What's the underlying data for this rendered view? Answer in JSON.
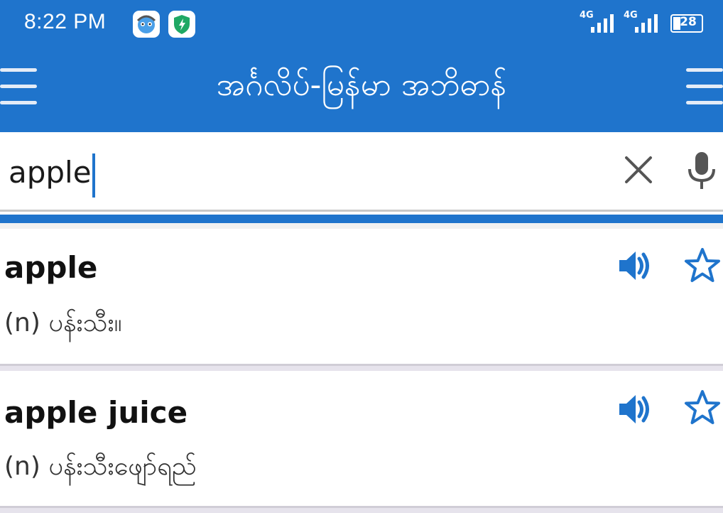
{
  "status_bar": {
    "time": "8:22 PM",
    "network_1": "4G",
    "network_2": "4G",
    "battery": "28"
  },
  "app_bar": {
    "title": "အင်္ဂလိပ်-မြန်မာ အဘိဓာန်",
    "left_icon": "menu-icon",
    "right_icon": "menu-icon"
  },
  "search": {
    "value": "apple",
    "clear_icon": "close-icon",
    "mic_icon": "microphone-icon"
  },
  "results": [
    {
      "word": "apple",
      "definition": "(n) ပန်းသီး။"
    },
    {
      "word": "apple juice",
      "definition": "(n) ပန်းသီးဖျော်ရည်"
    }
  ],
  "colors": {
    "primary": "#1f74cc",
    "separator": "#e6e3ec"
  }
}
